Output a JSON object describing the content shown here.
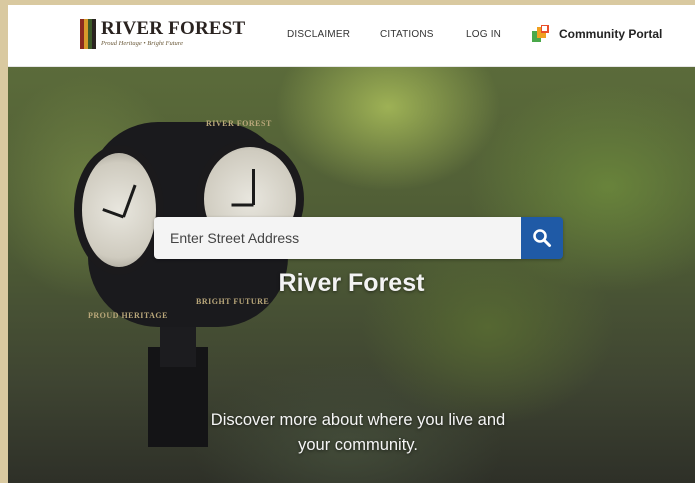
{
  "header": {
    "logo": {
      "name": "RIVER FOREST",
      "tagline": "Proud Heritage • Bright Future"
    },
    "nav": [
      {
        "label": "DISCLAIMER"
      },
      {
        "label": "CITATIONS"
      },
      {
        "label": "LOG IN"
      }
    ],
    "portal": {
      "label": "Community Portal",
      "icon": "portal-squares-icon"
    }
  },
  "hero": {
    "search": {
      "placeholder": "Enter Street Address",
      "button_icon": "search-icon"
    },
    "title": "River Forest",
    "subtitle": "Discover more about where you live and your community.",
    "clock_labels": [
      "RIVER FOREST",
      "BRIGHT FUTURE",
      "PROUD HERITAGE"
    ]
  },
  "colors": {
    "accent": "#1f5aa6",
    "header_bg": "#ffffff",
    "frame_bg": "#d9c9a0"
  }
}
